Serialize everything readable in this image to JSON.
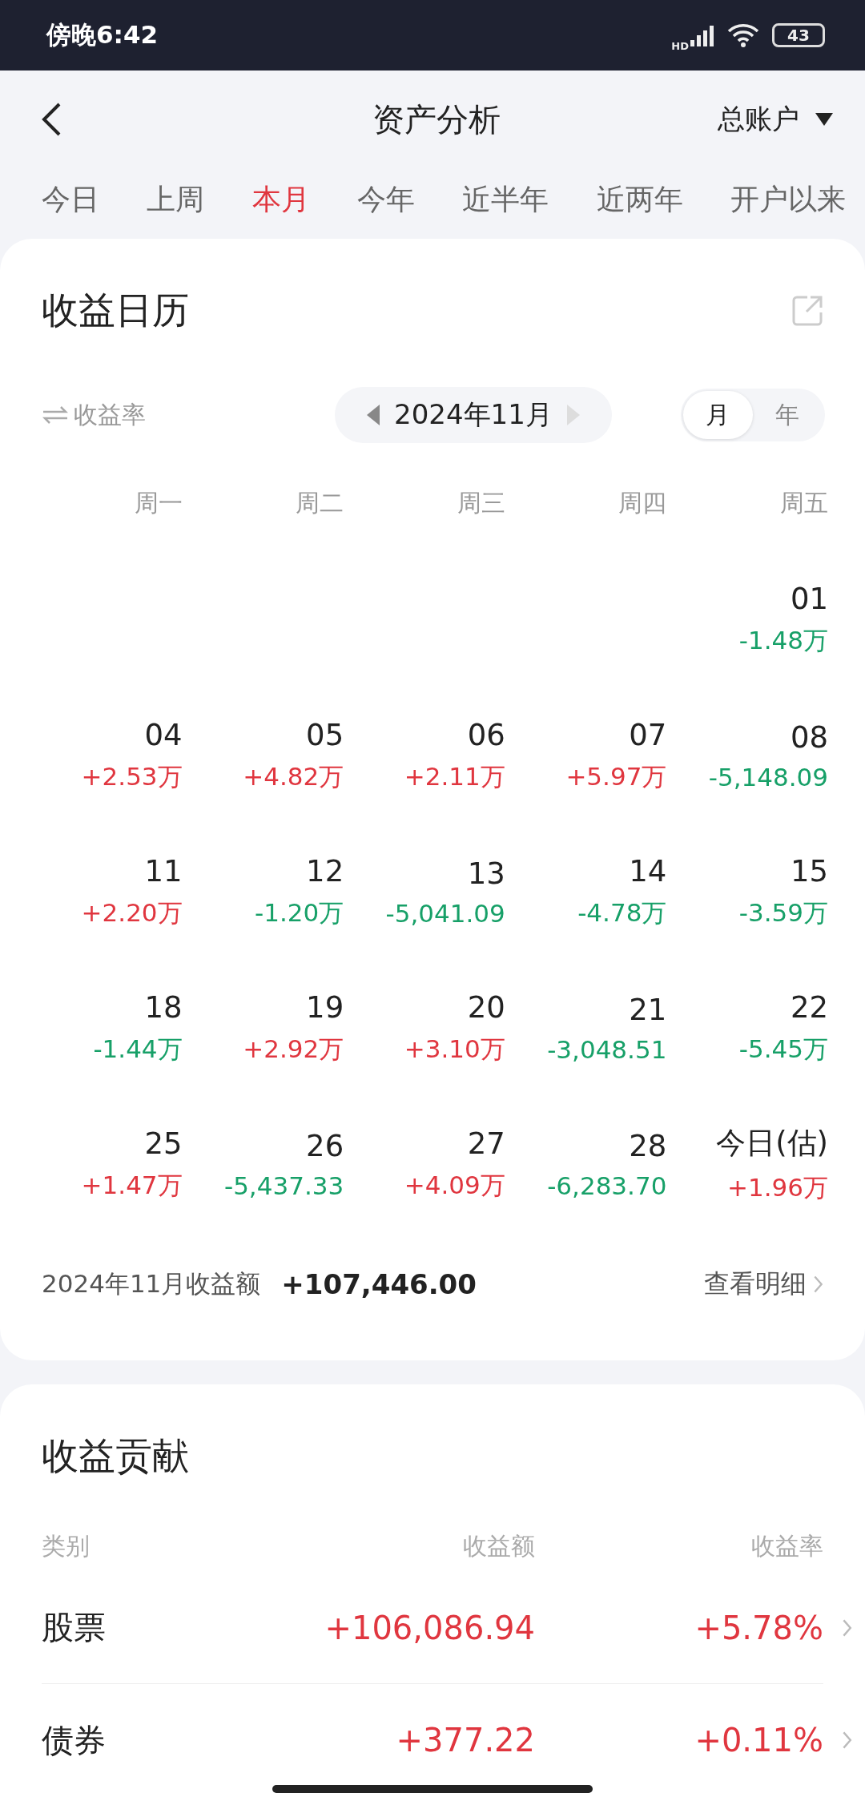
{
  "status_bar": {
    "time": "傍晚6:42",
    "network": "HD",
    "battery": "43"
  },
  "header": {
    "title": "资产分析",
    "account": "总账户"
  },
  "periods": [
    {
      "label": "今日",
      "selected": false
    },
    {
      "label": "上周",
      "selected": false
    },
    {
      "label": "本月",
      "selected": true
    },
    {
      "label": "今年",
      "selected": false
    },
    {
      "label": "近半年",
      "selected": false
    },
    {
      "label": "近两年",
      "selected": false
    },
    {
      "label": "开户以来",
      "selected": false
    }
  ],
  "calendar": {
    "title": "收益日历",
    "metric_toggle": "收益率",
    "month": "2024年11月",
    "views": [
      {
        "label": "月",
        "selected": true
      },
      {
        "label": "年",
        "selected": false
      }
    ],
    "weekdays": [
      "周一",
      "周二",
      "周三",
      "周四",
      "周五"
    ],
    "weeks": [
      [
        {
          "date": "01",
          "value": "-1.48万",
          "color": "#17a068"
        }
      ],
      [
        {
          "date": "04",
          "value": "+2.53万",
          "color": "#e0363f"
        },
        {
          "date": "05",
          "value": "+4.82万",
          "color": "#e0363f"
        },
        {
          "date": "06",
          "value": "+2.11万",
          "color": "#e0363f"
        },
        {
          "date": "07",
          "value": "+5.97万",
          "color": "#e0363f"
        },
        {
          "date": "08",
          "value": "-5,148.09",
          "color": "#17a068"
        }
      ],
      [
        {
          "date": "11",
          "value": "+2.20万",
          "color": "#e0363f"
        },
        {
          "date": "12",
          "value": "-1.20万",
          "color": "#17a068"
        },
        {
          "date": "13",
          "value": "-5,041.09",
          "color": "#17a068"
        },
        {
          "date": "14",
          "value": "-4.78万",
          "color": "#17a068"
        },
        {
          "date": "15",
          "value": "-3.59万",
          "color": "#17a068"
        }
      ],
      [
        {
          "date": "18",
          "value": "-1.44万",
          "color": "#17a068"
        },
        {
          "date": "19",
          "value": "+2.92万",
          "color": "#e0363f"
        },
        {
          "date": "20",
          "value": "+3.10万",
          "color": "#e0363f"
        },
        {
          "date": "21",
          "value": "-3,048.51",
          "color": "#17a068"
        },
        {
          "date": "22",
          "value": "-5.45万",
          "color": "#17a068"
        }
      ],
      [
        {
          "date": "25",
          "value": "+1.47万",
          "color": "#e0363f"
        },
        {
          "date": "26",
          "value": "-5,437.33",
          "color": "#17a068"
        },
        {
          "date": "27",
          "value": "+4.09万",
          "color": "#e0363f"
        },
        {
          "date": "28",
          "value": "-6,283.70",
          "color": "#17a068"
        },
        {
          "date": "今日(估)",
          "value": "+1.96万",
          "color": "#e0363f"
        }
      ]
    ],
    "summary_label": "2024年11月收益额",
    "summary_value": "+107,446.00",
    "details_link": "查看明细"
  },
  "contribution": {
    "title": "收益贡献",
    "columns": [
      "类别",
      "收益额",
      "收益率"
    ],
    "rows": [
      {
        "category": "股票",
        "amount": "+106,086.94",
        "rate": "+5.78%",
        "color": "#e0363f"
      },
      {
        "category": "债券",
        "amount": "+377.22",
        "rate": "+0.11%",
        "color": "#e0363f"
      }
    ]
  }
}
